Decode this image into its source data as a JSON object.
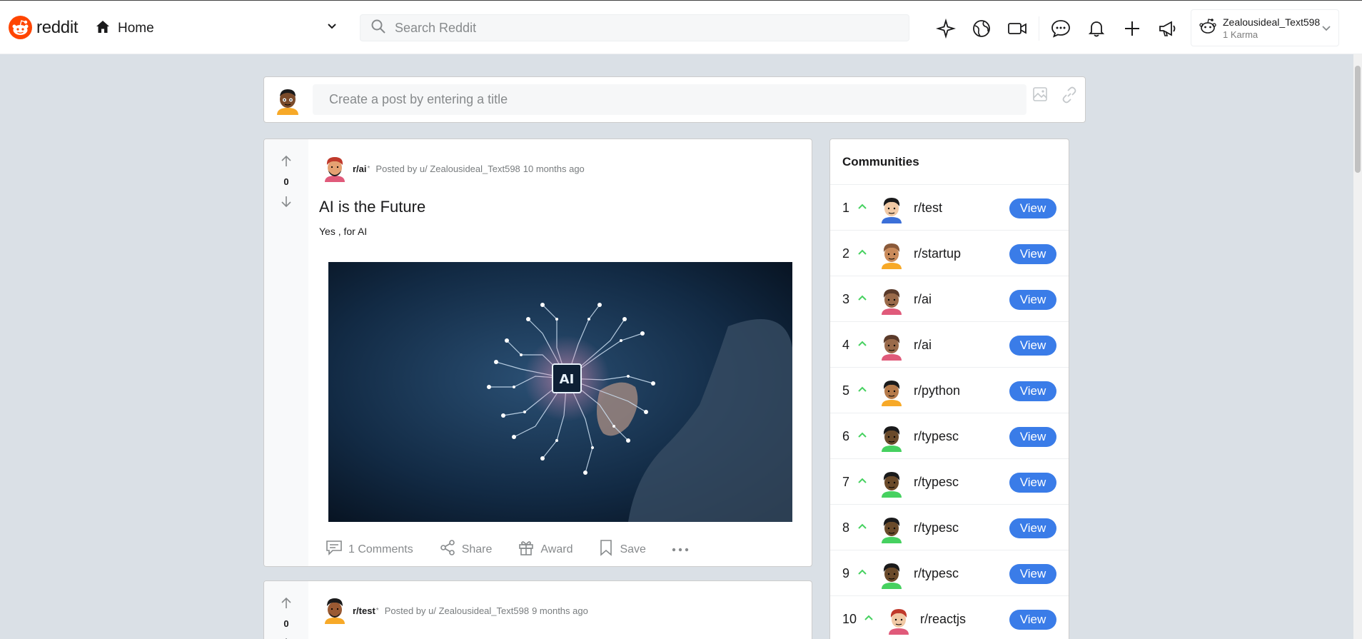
{
  "header": {
    "logo_text": "reddit",
    "home_label": "Home",
    "search_placeholder": "Search Reddit",
    "user": {
      "name": "Zealousideal_Text598",
      "karma": "1 Karma"
    },
    "icons": [
      "sparkle-icon",
      "globe-icon",
      "video-icon",
      "chat-icon",
      "bell-icon",
      "plus-icon",
      "megaphone-icon"
    ]
  },
  "create_post": {
    "placeholder": "Create a post by entering a title"
  },
  "posts": [
    {
      "votes": "0",
      "subreddit": "r/ai",
      "marker": "*",
      "posted_by": "Posted by u/ Zealousideal_Text598",
      "time": "10 months ago",
      "title": "AI is the Future",
      "body": "Yes , for AI",
      "image_text": "AI",
      "actions": {
        "comments": "1 Comments",
        "share": "Share",
        "award": "Award",
        "save": "Save"
      }
    },
    {
      "votes": "0",
      "subreddit": "r/test",
      "marker": "*",
      "posted_by": "Posted by u/ Zealousideal_Text598",
      "time": "9 months ago"
    }
  ],
  "communities": {
    "title": "Communities",
    "view_label": "View",
    "items": [
      {
        "rank": "1",
        "name": "r/test"
      },
      {
        "rank": "2",
        "name": "r/startup"
      },
      {
        "rank": "3",
        "name": "r/ai"
      },
      {
        "rank": "4",
        "name": "r/ai"
      },
      {
        "rank": "5",
        "name": "r/python"
      },
      {
        "rank": "6",
        "name": "r/typesc"
      },
      {
        "rank": "7",
        "name": "r/typesc"
      },
      {
        "rank": "8",
        "name": "r/typesc"
      },
      {
        "rank": "9",
        "name": "r/typesc"
      },
      {
        "rank": "10",
        "name": "r/reactjs"
      }
    ]
  },
  "colors": {
    "brand": "#ff4500",
    "view_button": "#3a7ce8",
    "upvote_green": "#46d160",
    "background": "#dae0e6"
  }
}
